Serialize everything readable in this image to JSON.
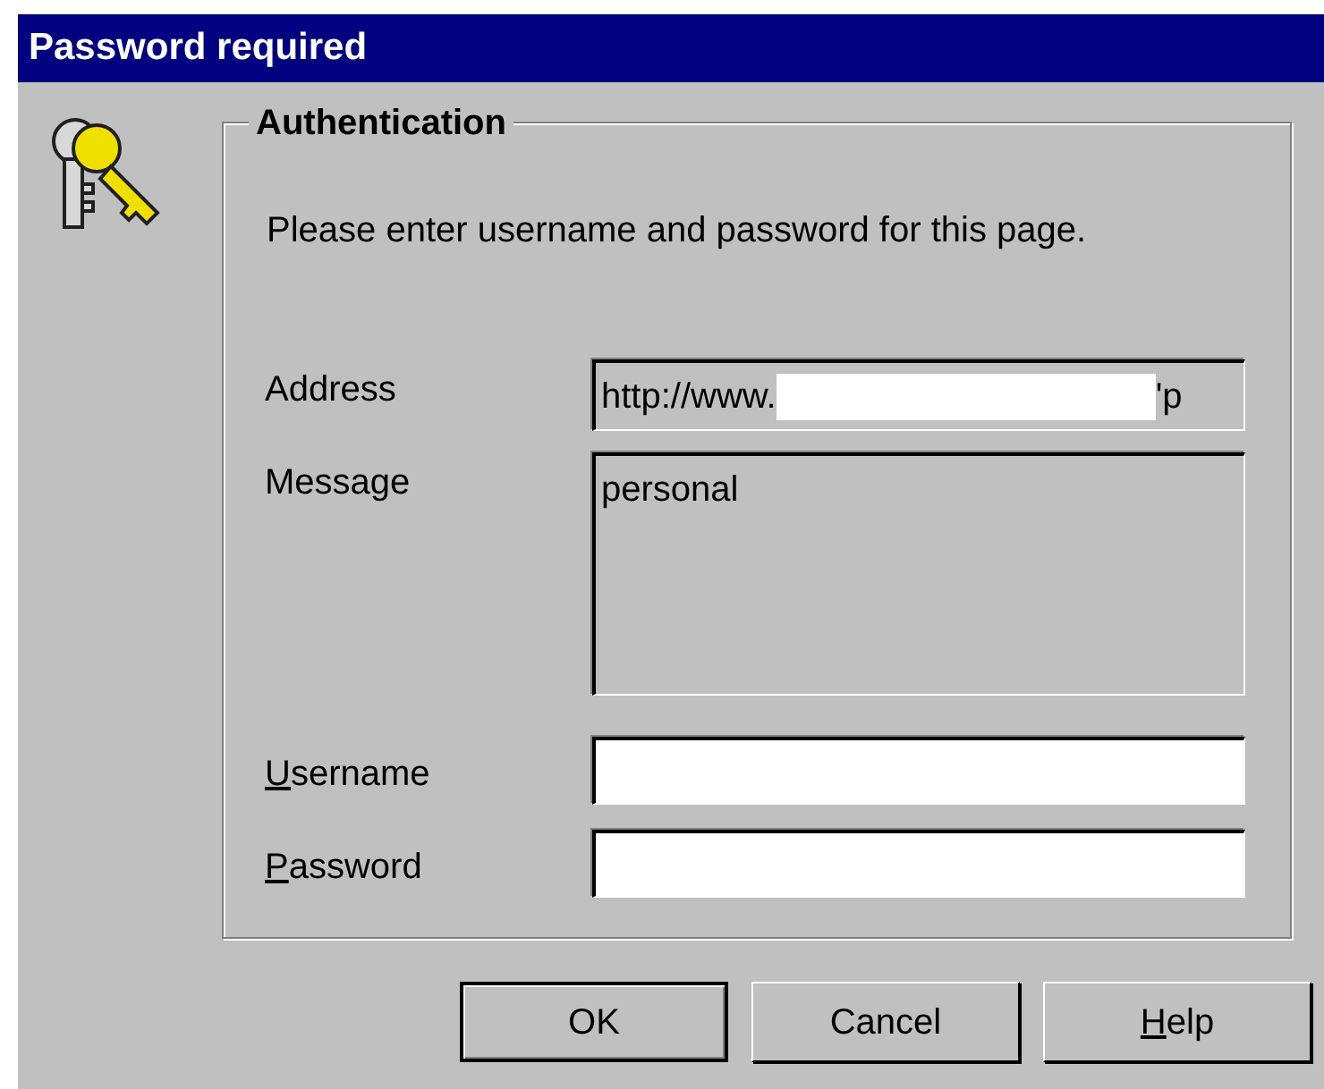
{
  "window": {
    "title": "Password required"
  },
  "group": {
    "legend": "Authentication",
    "intro": "Please enter username and password for this page."
  },
  "address": {
    "label": "Address",
    "prefix": "http://www.",
    "redacted": true,
    "suffix": "'p"
  },
  "message": {
    "label": "Message",
    "value": "personal"
  },
  "fields": [
    {
      "key": "U",
      "rest": "sername"
    },
    {
      "key": "P",
      "rest": "assword"
    }
  ],
  "buttons": [
    {
      "rest": "OK",
      "default": true
    },
    {
      "rest": "Cancel",
      "default": false
    },
    {
      "key": "H",
      "rest": "elp",
      "default": false
    }
  ]
}
